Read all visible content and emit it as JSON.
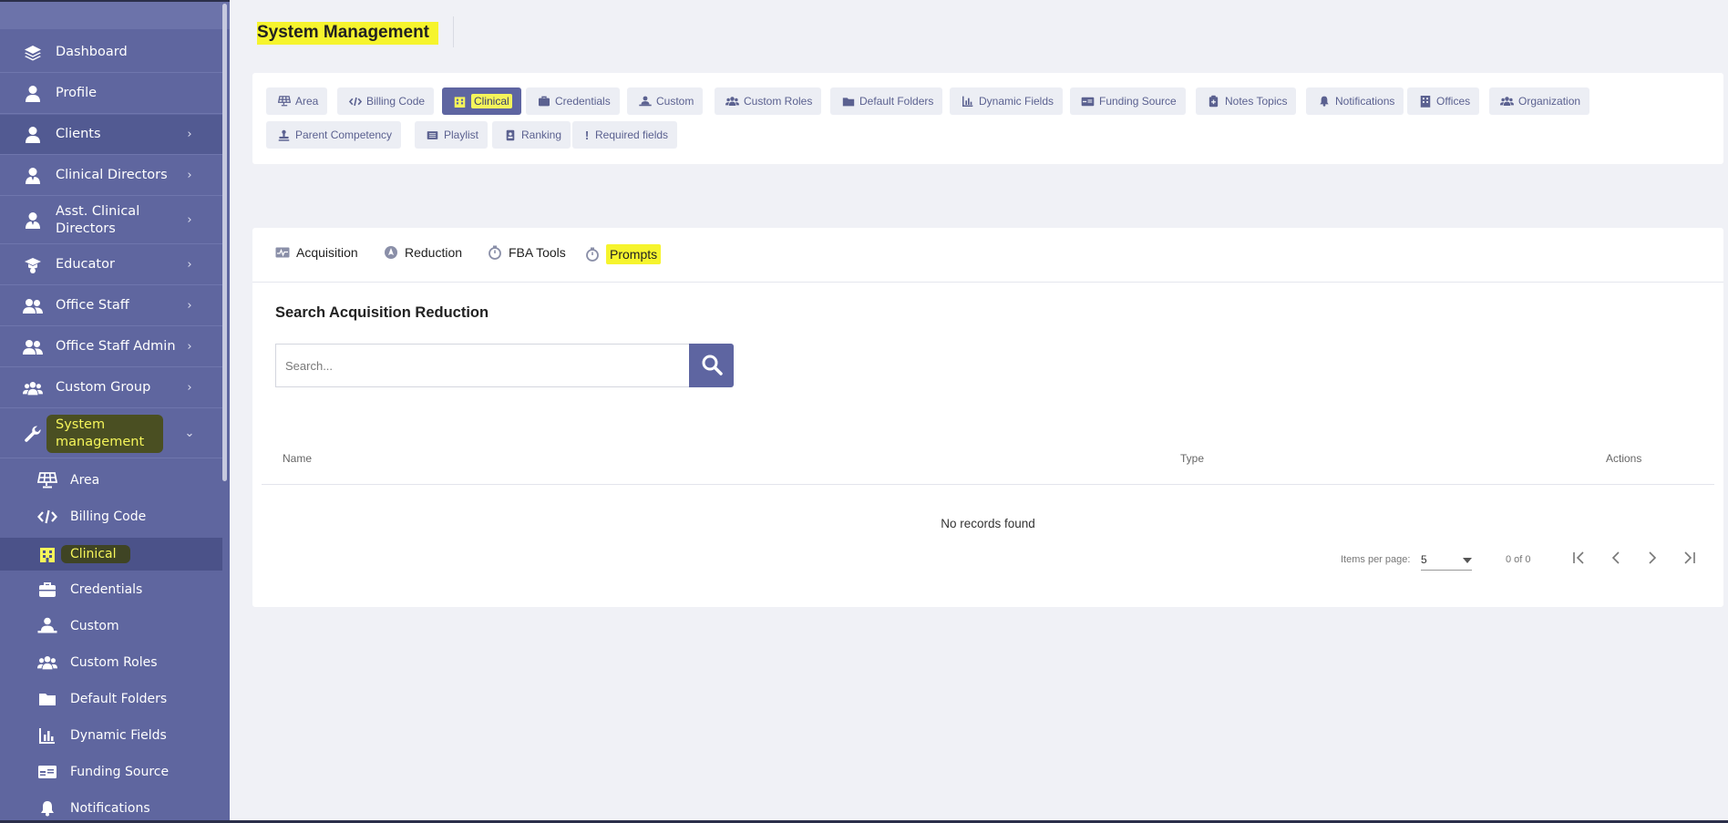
{
  "page_title": "System Management",
  "sidebar": {
    "items": [
      {
        "label": "Dashboard",
        "icon": "layers-icon"
      },
      {
        "label": "Profile",
        "icon": "user-icon"
      },
      {
        "label": "Clients",
        "icon": "user-icon"
      },
      {
        "label": "Clinical Directors",
        "icon": "user-tie-icon"
      },
      {
        "label": "Asst. Clinical Directors",
        "icon": "user-tie-icon"
      },
      {
        "label": "Educator",
        "icon": "graduation-cap-icon"
      },
      {
        "label": "Office Staff",
        "icon": "users-icon"
      },
      {
        "label": "Office Staff Admin",
        "icon": "users-icon"
      },
      {
        "label": "Custom Group",
        "icon": "group-icon"
      },
      {
        "label": "System management",
        "icon": "wrench-icon"
      }
    ],
    "sub_items": [
      {
        "label": "Area",
        "icon": "solar-panel-icon"
      },
      {
        "label": "Billing Code",
        "icon": "code-icon"
      },
      {
        "label": "Clinical",
        "icon": "building-icon"
      },
      {
        "label": "Credentials",
        "icon": "briefcase-icon"
      },
      {
        "label": "Custom",
        "icon": "person-desk-icon"
      },
      {
        "label": "Custom Roles",
        "icon": "group-icon"
      },
      {
        "label": "Default Folders",
        "icon": "folder-icon"
      },
      {
        "label": "Dynamic Fields",
        "icon": "bar-chart-icon"
      },
      {
        "label": "Funding Source",
        "icon": "id-card-icon"
      },
      {
        "label": "Notifications",
        "icon": "bell-icon"
      }
    ]
  },
  "top_tabs": [
    "Area",
    "Billing Code",
    "Clinical",
    "Credentials",
    "Custom",
    "Custom Roles",
    "Default Folders",
    "Dynamic Fields",
    "Funding Source",
    "Notes Topics",
    "Notifications",
    "Offices",
    "Organization",
    "Parent Competency",
    "Playlist",
    "Ranking",
    "Required fields"
  ],
  "sub_tabs": [
    "Acquisition",
    "Reduction",
    "FBA Tools",
    "Prompts"
  ],
  "search": {
    "title": "Search Acquisition Reduction",
    "placeholder": "Search..."
  },
  "table": {
    "headers": [
      "Name",
      "Type",
      "Actions"
    ],
    "empty_text": "No records found"
  },
  "pagination": {
    "items_per_page_label": "Items per page:",
    "items_per_page_value": "5",
    "range_text": "0 of 0"
  },
  "colors": {
    "sidebar": "#5f669f",
    "accent": "#5e65a1",
    "highlight": "#f6f42d"
  }
}
